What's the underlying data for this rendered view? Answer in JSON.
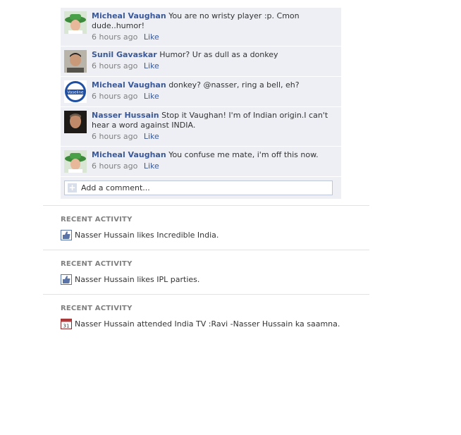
{
  "comments": [
    {
      "name": "Micheal Vaughan",
      "text": "You are no wristy player :p. Cmon dude..humor!",
      "time": "6 hours ago",
      "like": "Like",
      "avatar": "hat"
    },
    {
      "name": "Sunil Gavaskar",
      "text": "Humor? Ur as dull as a donkey",
      "time": "6 hours ago",
      "like": "Like",
      "avatar": "man"
    },
    {
      "name": "Micheal Vaughan",
      "text": "donkey? @nasser, ring a bell, eh?",
      "time": "6 hours ago",
      "like": "Like",
      "avatar": "logo",
      "logo_text": "Vaseline"
    },
    {
      "name": "Nasser Hussain",
      "text": "Stop it Vaughan! I'm of Indian origin.I can't hear a word against INDIA.",
      "time": "6 hours ago",
      "like": "Like",
      "avatar": "nasser"
    },
    {
      "name": "Micheal Vaughan",
      "text": "You confuse me mate, i'm off this now.",
      "time": "6 hours ago",
      "like": "Like",
      "avatar": "hat"
    }
  ],
  "add_comment": {
    "placeholder": "Add a comment..."
  },
  "activities": [
    {
      "title": "RECENT ACTIVITY",
      "text": "Nasser Hussain likes Incredible India.",
      "icon": "thumbs-up-icon"
    },
    {
      "title": "RECENT ACTIVITY",
      "text": "Nasser Hussain likes IPL parties.",
      "icon": "thumbs-up-icon"
    },
    {
      "title": "RECENT ACTIVITY",
      "text": "Nasser Hussain attended India TV :Ravi -Nasser Hussain ka saamna.",
      "icon": "calendar-icon",
      "calendar_day": "31"
    }
  ],
  "colors": {
    "name_link": "#3b5998",
    "comment_bg": "#edeff4",
    "meta": "#808080"
  }
}
